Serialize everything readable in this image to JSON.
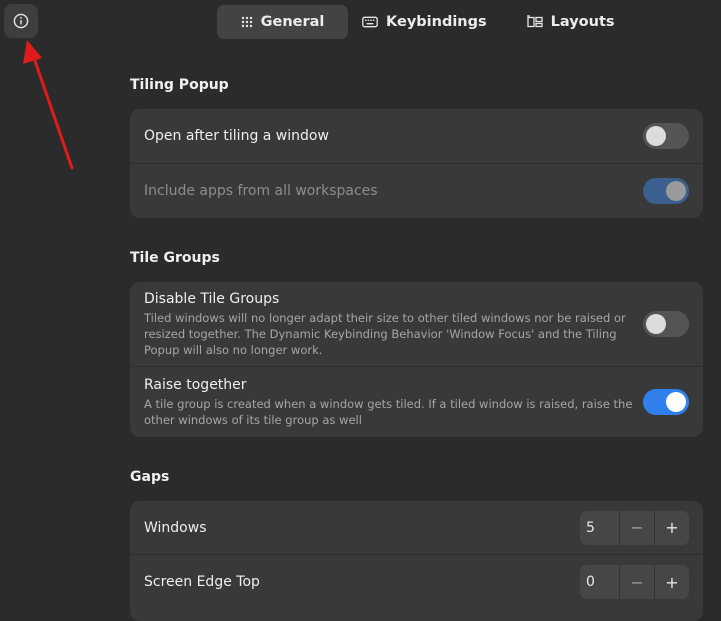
{
  "header": {
    "info_icon": "info-circle-icon",
    "tabs": [
      {
        "label": "General",
        "icon": "grid-icon",
        "active": true
      },
      {
        "label": "Keybindings",
        "icon": "keyboard-icon",
        "active": false
      },
      {
        "label": "Layouts",
        "icon": "layout-icon",
        "active": false
      }
    ]
  },
  "annotation": {
    "arrow_color": "#e01b1b"
  },
  "sections": {
    "tiling_popup": {
      "title": "Tiling Popup",
      "open_after_tiling": {
        "label": "Open after tiling a window",
        "enabled": false
      },
      "include_apps": {
        "label": "Include apps from all workspaces",
        "enabled": true,
        "sensitive": false
      }
    },
    "tile_groups": {
      "title": "Tile Groups",
      "disable_tile_groups": {
        "label": "Disable Tile Groups",
        "subtitle": "Tiled windows will no longer adapt their size to other tiled windows nor be raised or resized together. The Dynamic Keybinding Behavior 'Window Focus' and the Tiling Popup will also no longer work.",
        "enabled": false
      },
      "raise_together": {
        "label": "Raise together",
        "subtitle": "A tile group is created when a window gets tiled. If a tiled window is raised, raise the other windows of its tile group as well",
        "enabled": true
      }
    },
    "gaps": {
      "title": "Gaps",
      "windows": {
        "label": "Windows",
        "value": "5",
        "minus": "−",
        "plus": "+"
      },
      "screen_edge_top": {
        "label": "Screen Edge Top",
        "value": "0",
        "minus": "−",
        "plus": "+"
      }
    }
  },
  "colors": {
    "accent": "#2f80ed",
    "background": "#2b2b2b",
    "card": "#393939"
  }
}
